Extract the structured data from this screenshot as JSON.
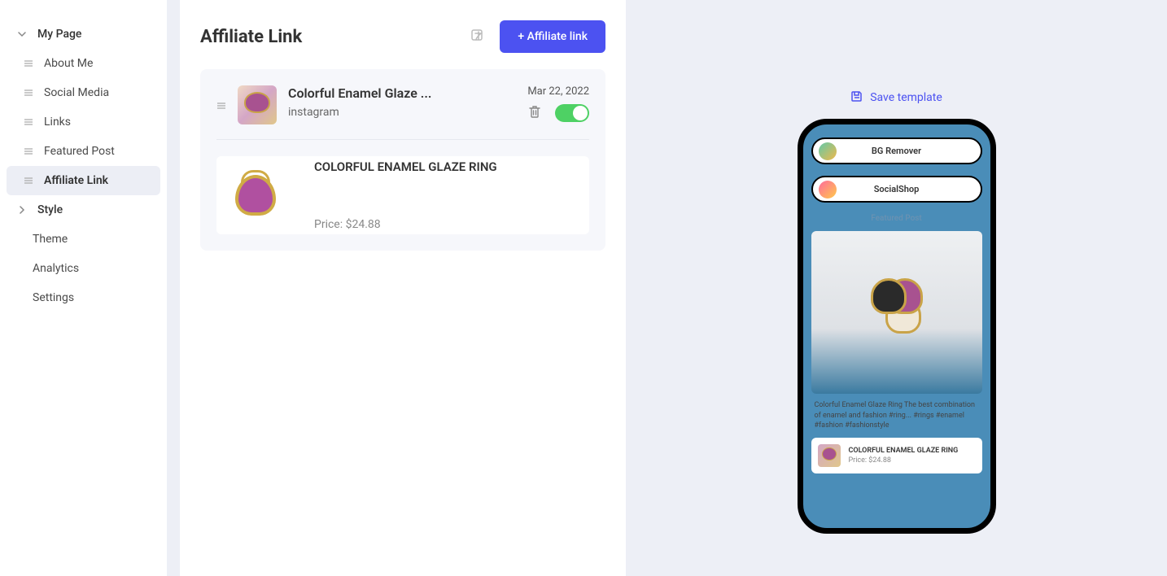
{
  "sidebar": {
    "my_page": "My Page",
    "items": {
      "about_me": "About Me",
      "social_media": "Social Media",
      "links": "Links",
      "featured_post": "Featured Post",
      "affiliate_link": "Affiliate Link"
    },
    "style": "Style",
    "theme": "Theme",
    "analytics": "Analytics",
    "settings": "Settings"
  },
  "main": {
    "title": "Affiliate Link",
    "add_button": "+ Affiliate link",
    "card": {
      "title": "Colorful Enamel Glaze ...",
      "subtitle": "instagram",
      "date": "Mar 22, 2022"
    },
    "product": {
      "title": "COLORFUL ENAMEL GLAZE RING",
      "price": "Price: $24.88"
    }
  },
  "preview": {
    "save_template": "Save template",
    "pill1": "BG Remover",
    "pill2": "SocialShop",
    "featured": "Featured Post",
    "desc": "Colorful Enamel Glaze Ring The best combination of enamel and fashion #ring... #rings #enamel #fashion #fashionstyle",
    "product_title": "COLORFUL ENAMEL GLAZE RING",
    "product_price": "Price: $24.88"
  }
}
